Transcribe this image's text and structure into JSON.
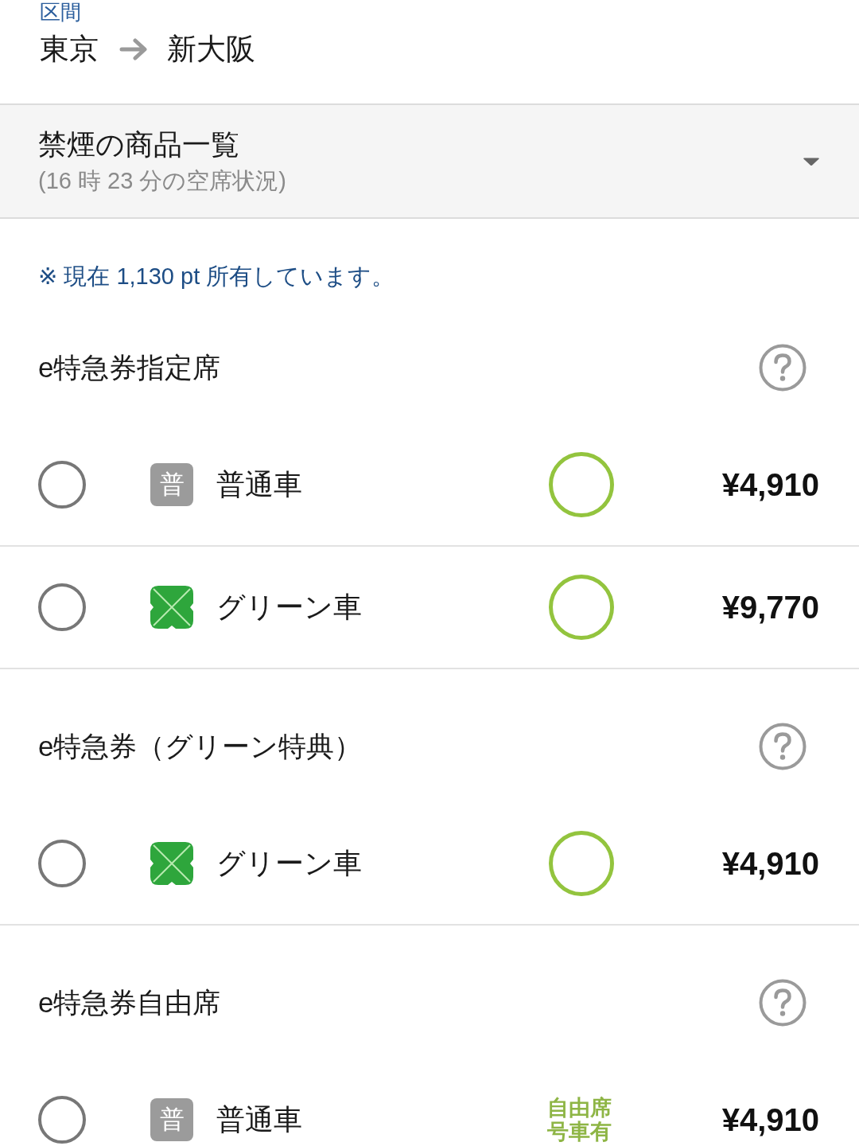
{
  "route": {
    "label": "区間",
    "from": "東京",
    "to": "新大阪"
  },
  "product_panel": {
    "title": "禁煙の商品一覧",
    "subtitle": "(16 時 23 分の空席状況)",
    "expanded": false
  },
  "points_note": "※ 現在 1,130 pt 所有しています。",
  "ticket_groups": [
    {
      "title": "e特急券指定席",
      "options": [
        {
          "kind": "ordinary",
          "badge": "普",
          "name": "普通車",
          "availability": {
            "kind": "circle"
          },
          "price": "¥4,910",
          "selected": false
        },
        {
          "kind": "green",
          "name": "グリーン車",
          "availability": {
            "kind": "circle"
          },
          "price": "¥9,770",
          "selected": false
        }
      ]
    },
    {
      "title": "e特急券（グリーン特典）",
      "options": [
        {
          "kind": "green",
          "name": "グリーン車",
          "availability": {
            "kind": "circle"
          },
          "price": "¥4,910",
          "selected": false
        }
      ]
    },
    {
      "title": "e特急券自由席",
      "options": [
        {
          "kind": "ordinary",
          "badge": "普",
          "name": "普通車",
          "availability": {
            "kind": "text",
            "text": "自由席号車有"
          },
          "price": "¥4,910",
          "selected": false
        }
      ]
    }
  ]
}
